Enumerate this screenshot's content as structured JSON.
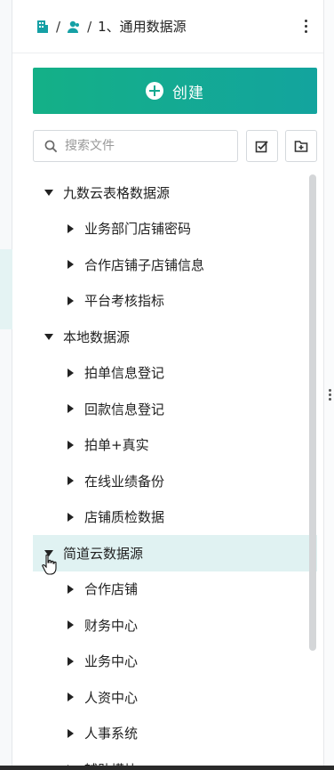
{
  "header": {
    "crumb_sep1": "/",
    "crumb_sep2": "/",
    "current": "1、通用数据源",
    "more_icon": "more-vertical-icon"
  },
  "toolbar": {
    "create_label": "创建",
    "search_placeholder": "搜索文件",
    "select_icon": "checkbox-select-icon",
    "new_folder_icon": "folder-add-icon"
  },
  "tree": {
    "groups": [
      {
        "label": "九数云表格数据源",
        "expanded": true,
        "items": [
          "业务部门店铺密码",
          "合作店铺子店铺信息",
          "平台考核指标"
        ]
      },
      {
        "label": "本地数据源",
        "expanded": true,
        "items": [
          "拍单信息登记",
          "回款信息登记",
          "拍单+真实",
          "在线业绩备份",
          "店铺质检数据"
        ]
      },
      {
        "label": "简道云数据源",
        "expanded": true,
        "hovered": true,
        "items": [
          "合作店铺",
          "财务中心",
          "业务中心",
          "人资中心",
          "人事系统",
          "辅助模块"
        ]
      }
    ]
  },
  "colors": {
    "accent_start": "#14b087",
    "accent_end": "#13a49e",
    "hover_row": "#e0f2f2"
  }
}
